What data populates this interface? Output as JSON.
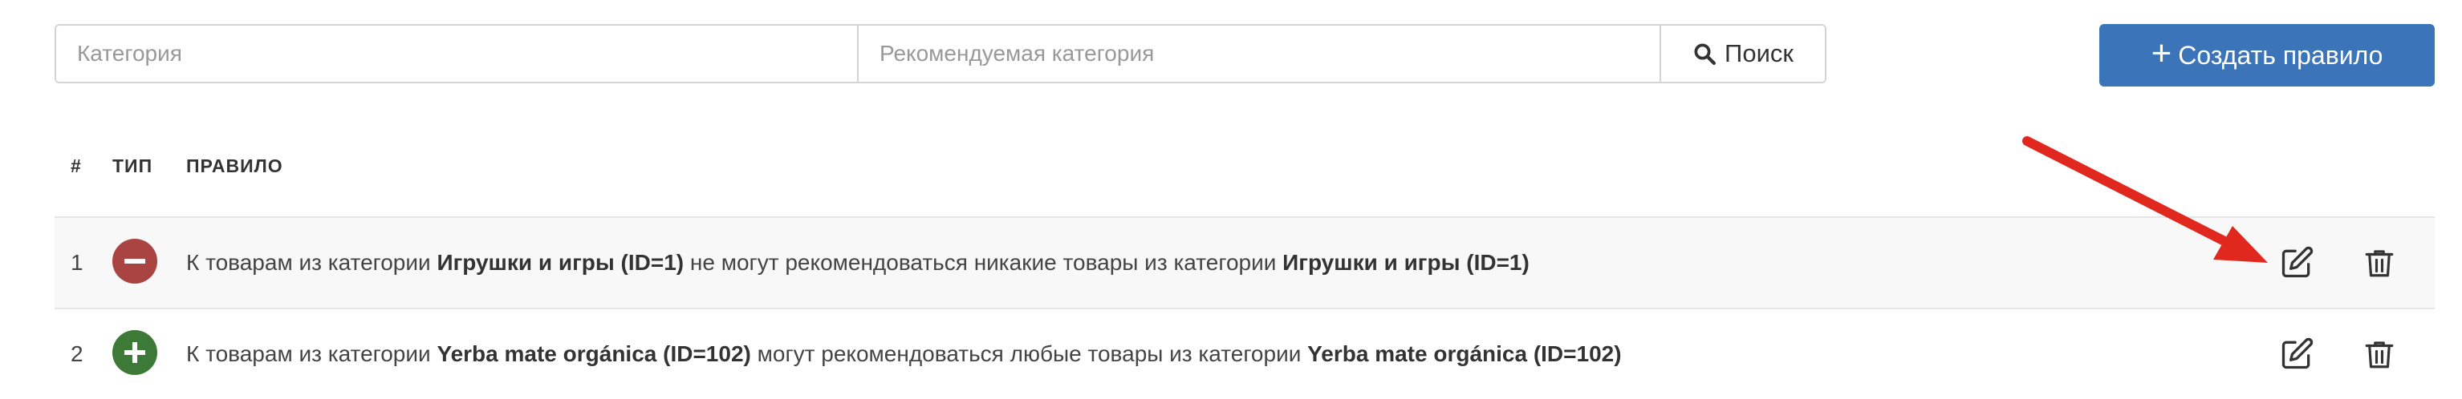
{
  "filters": {
    "category_placeholder": "Категория",
    "recommended_placeholder": "Рекомендуемая категория",
    "search_label": "Поиск"
  },
  "create_button": {
    "label": "Создать правило"
  },
  "table": {
    "columns": [
      "#",
      "ТИП",
      "ПРАВИЛО"
    ],
    "rows": [
      {
        "num": "1",
        "type": "minus",
        "rule": {
          "p1": "К товарам из категории ",
          "b1": "Игрушки и игры (ID=1)",
          "p2": " не могут рекомендоваться никакие товары из категории ",
          "b2": "Игрушки и игры (ID=1)"
        }
      },
      {
        "num": "2",
        "type": "plus",
        "rule": {
          "p1": "К товарам из категории ",
          "b1": "Yerba mate orgánica (ID=102)",
          "p2": " могут рекомендоваться любые товары из категории ",
          "b2": "Yerba mate orgánica (ID=102)"
        }
      }
    ]
  },
  "colors": {
    "primary": "#3b74b9",
    "danger": "#a94442",
    "success": "#3d7a37",
    "annotation_arrow": "#e0281e"
  },
  "icons": [
    "search-icon",
    "plus-icon",
    "minus-icon",
    "edit-icon",
    "trash-icon"
  ]
}
